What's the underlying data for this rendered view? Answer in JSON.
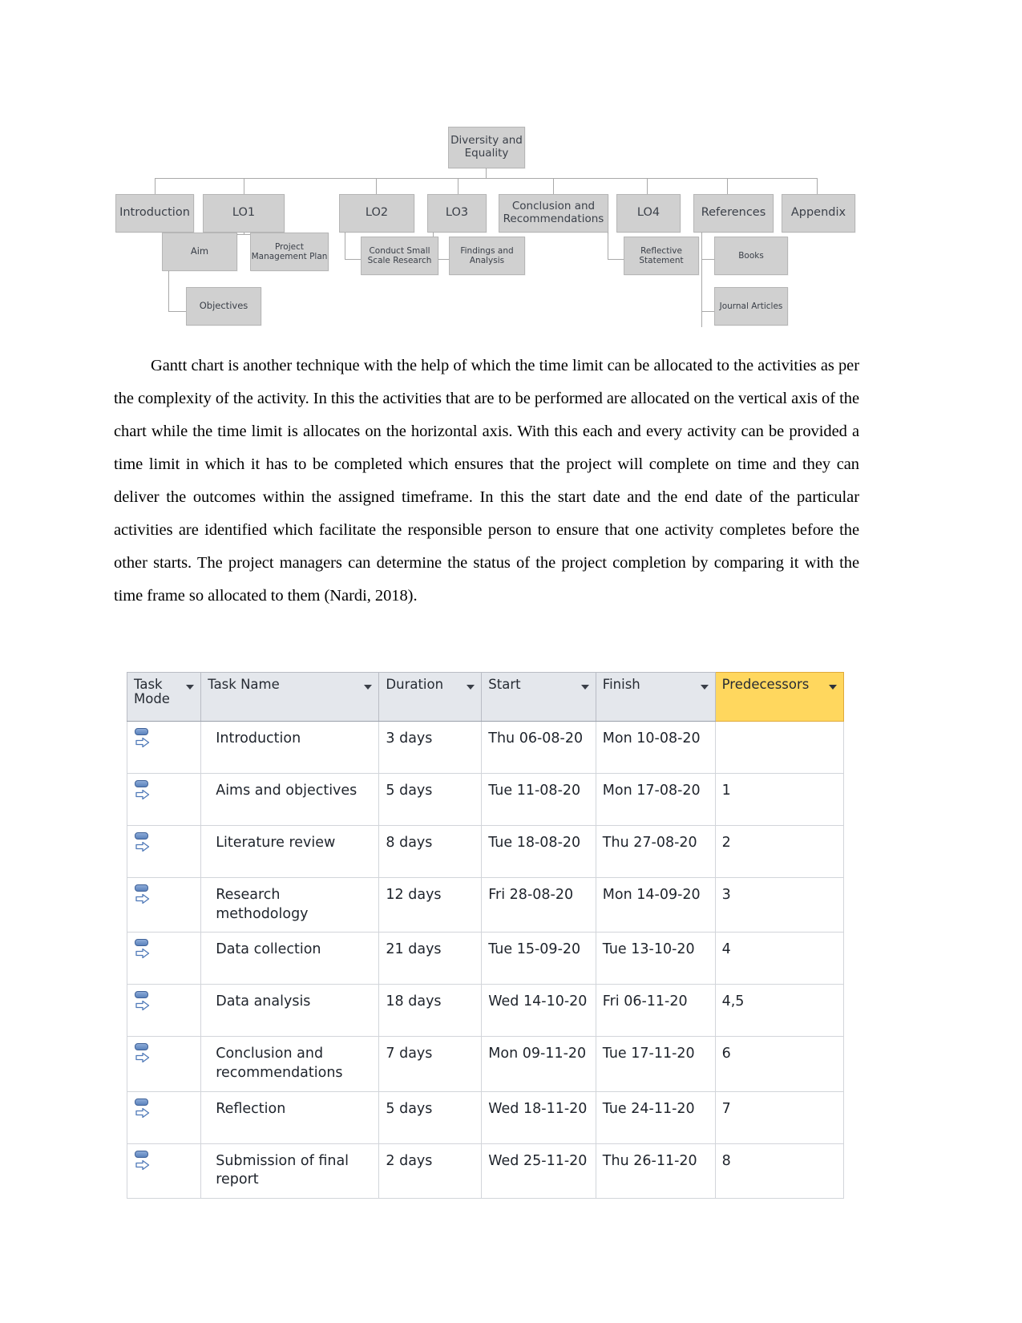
{
  "diagram": {
    "root": {
      "label": "Diversity and Equality"
    },
    "level1": [
      {
        "label": "Introduction"
      },
      {
        "label": "LO1"
      },
      {
        "label": "LO2"
      },
      {
        "label": "LO3"
      },
      {
        "label": "Conclusion and Recommendations"
      },
      {
        "label": "LO4"
      },
      {
        "label": "References"
      },
      {
        "label": "Appendix"
      }
    ],
    "level2": [
      {
        "label": "Aim"
      },
      {
        "label": "Project Management Plan"
      },
      {
        "label": "Conduct Small Scale Research"
      },
      {
        "label": "Findings and Analysis"
      },
      {
        "label": "Reflective Statement"
      },
      {
        "label": "Books"
      }
    ],
    "level3": [
      {
        "label": "Objectives"
      },
      {
        "label": "Journal Articles"
      }
    ],
    "colors": {
      "node_fill": "#d0d0d0",
      "node_border": "#b6b6b6",
      "connector": "#a9a9a9",
      "text": "#3b4049"
    }
  },
  "paragraph": {
    "text": "Gantt chart is another technique with the help of which the time limit can be allocated to the activities as per the complexity of the activity. In this the activities that are to be performed are allocated on the vertical axis of the chart while the time limit is allocates on the horizontal axis. With this each and every activity can be provided a time limit in which it has to be completed which ensures that the project will complete on time and they can deliver the outcomes within the assigned timeframe. In this the start date and the end date of the particular activities are identified which facilitate the responsible person to ensure that one activity completes before the other starts. The project managers can determine the status of the project completion by comparing it with the time frame so allocated to them (Nardi, 2018)."
  },
  "task_table": {
    "columns": [
      {
        "key": "task_mode",
        "label": "Task Mode",
        "highlight": false,
        "filter_icon": "filter-caret-icon"
      },
      {
        "key": "task_name",
        "label": "Task Name",
        "highlight": false,
        "filter_icon": "filter-caret-icon"
      },
      {
        "key": "duration",
        "label": "Duration",
        "highlight": false,
        "filter_icon": "filter-caret-icon"
      },
      {
        "key": "start",
        "label": "Start",
        "highlight": false,
        "filter_icon": "filter-caret-icon"
      },
      {
        "key": "finish",
        "label": "Finish",
        "highlight": false,
        "filter_icon": "filter-caret-icon"
      },
      {
        "key": "predecessors",
        "label": "Predecessors",
        "highlight": true,
        "filter_icon": "filter-caret-icon"
      }
    ],
    "header_highlight_color": "#ffd75e",
    "header_background_color": "#e4e7ec",
    "mode_icon_name": "auto-scheduled-task-icon",
    "rows": [
      {
        "task_mode": "auto-scheduled-task-icon",
        "task_name": "Introduction",
        "duration": "3 days",
        "start": "Thu 06-08-20",
        "finish": "Mon 10-08-20",
        "predecessors": ""
      },
      {
        "task_mode": "auto-scheduled-task-icon",
        "task_name": "Aims and objectives",
        "duration": "5 days",
        "start": "Tue 11-08-20",
        "finish": "Mon 17-08-20",
        "predecessors": "1"
      },
      {
        "task_mode": "auto-scheduled-task-icon",
        "task_name": "Literature review",
        "duration": "8 days",
        "start": "Tue 18-08-20",
        "finish": "Thu 27-08-20",
        "predecessors": "2"
      },
      {
        "task_mode": "auto-scheduled-task-icon",
        "task_name": "Research methodology",
        "duration": "12 days",
        "start": "Fri 28-08-20",
        "finish": "Mon 14-09-20",
        "predecessors": "3"
      },
      {
        "task_mode": "auto-scheduled-task-icon",
        "task_name": "Data collection",
        "duration": "21 days",
        "start": "Tue 15-09-20",
        "finish": "Tue 13-10-20",
        "predecessors": "4"
      },
      {
        "task_mode": "auto-scheduled-task-icon",
        "task_name": "Data analysis",
        "duration": "18 days",
        "start": "Wed 14-10-20",
        "finish": "Fri 06-11-20",
        "predecessors": "4,5"
      },
      {
        "task_mode": "auto-scheduled-task-icon",
        "task_name": "Conclusion and recommendations",
        "duration": "7 days",
        "start": "Mon 09-11-20",
        "finish": "Tue 17-11-20",
        "predecessors": "6"
      },
      {
        "task_mode": "auto-scheduled-task-icon",
        "task_name": "Reflection",
        "duration": "5 days",
        "start": "Wed 18-11-20",
        "finish": "Tue 24-11-20",
        "predecessors": "7"
      },
      {
        "task_mode": "auto-scheduled-task-icon",
        "task_name": "Submission of final report",
        "duration": "2 days",
        "start": "Wed 25-11-20",
        "finish": "Thu 26-11-20",
        "predecessors": "8"
      }
    ]
  }
}
